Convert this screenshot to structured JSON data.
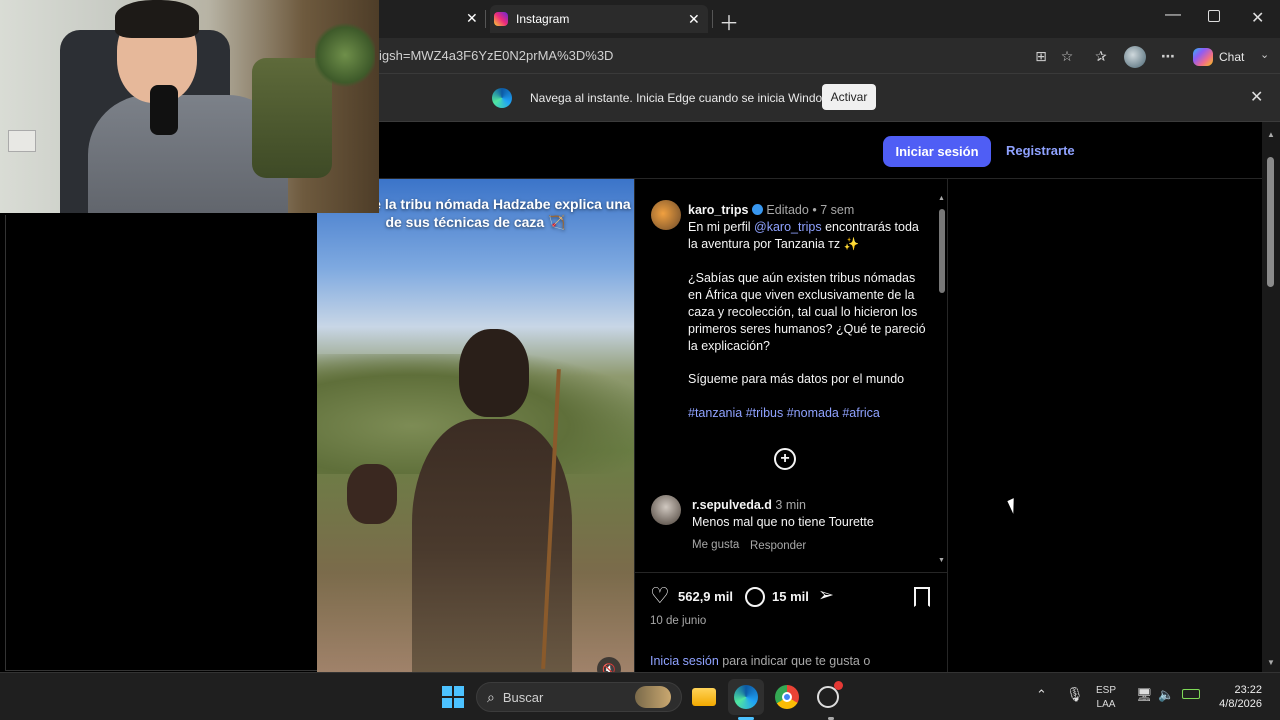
{
  "browser": {
    "tabs": [
      {
        "title": ""
      },
      {
        "title": "Instagram"
      }
    ],
    "address": "igsh=MWZ4a3F6YzE0N2prMA%3D%3D",
    "chat_label": "Chat",
    "infobar": {
      "message": "Navega al instante. Inicia Edge cuando se inicia Windows.",
      "button": "Activar"
    }
  },
  "header": {
    "login": "Iniciar sesión",
    "signup": "Registrarte"
  },
  "video": {
    "caption": "Joven de la tribu nómada Hadzabe explica una de sus técnicas de caza 🏹"
  },
  "post": {
    "author": "karo_trips",
    "edited": "Editado",
    "dot": "•",
    "age": "7 sem",
    "caption_prefix": "En mi perfil",
    "caption_mention": "@karo_trips",
    "caption_suffix": "encontrarás toda la aventura por Tanzania ᴛᴢ ✨",
    "caption_p2": "¿Sabías que aún existen tribus nómadas en África que viven exclusivamente de la caza y recolección, tal cual lo hicieron los primeros seres humanos? ¿Qué te pareció la explicación?",
    "caption_p3": "Sígueme para más datos por el mundo",
    "hashtags": [
      "#tanzania",
      "#tribus",
      "#nomada",
      "#africa"
    ],
    "comment": {
      "user": "r.sepulveda.d",
      "age": "3 min",
      "text": "Menos mal que no tiene Tourette",
      "like": "Me gusta",
      "reply": "Responder"
    },
    "likes": "562,9 mil",
    "comments_count": "15 mil",
    "date": "10 de junio",
    "login_prompt_link": "Inicia sesión",
    "login_prompt_text": "para indicar que te gusta o"
  },
  "taskbar": {
    "search_placeholder": "Buscar",
    "lang_top": "ESP",
    "lang_bottom": "LAA",
    "time": "23:22",
    "date": "4/8/2026"
  },
  "colors": {
    "accent": "#4f5ef5",
    "link": "#8fa2ff",
    "verified": "#3897f0"
  }
}
